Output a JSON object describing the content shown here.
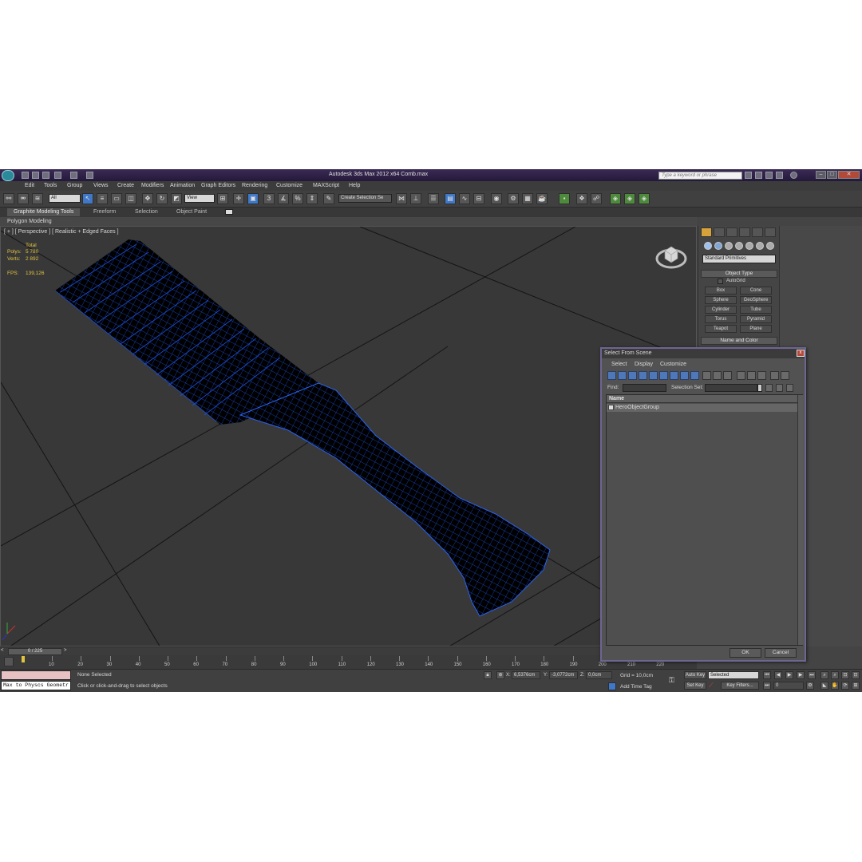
{
  "window": {
    "title": "Autodesk 3ds Max  2012 x64      Comb.max",
    "search_placeholder": "Type a keyword or phrase",
    "min_label": "–",
    "max_label": "□",
    "close_label": "✕"
  },
  "menu": [
    "Edit",
    "Tools",
    "Group",
    "Views",
    "Create",
    "Modifiers",
    "Animation",
    "Graph Editors",
    "Rendering",
    "Customize",
    "MAXScript",
    "Help"
  ],
  "toolbar": {
    "filter_value": "All",
    "ref_coord_value": "View",
    "named_selection_value": "Create Selection Se",
    "snap_label": "3"
  },
  "ribbon": {
    "tabs": [
      "Graphite Modeling Tools",
      "Freeform",
      "Selection",
      "Object Paint"
    ],
    "active_tab": "Graphite Modeling Tools",
    "panel_label": "Polygon Modeling"
  },
  "viewport": {
    "label": "[ + ] [ Perspective ] [ Realistic + Edged Faces ]",
    "stats": {
      "total_label": "Total",
      "polys_label": "Polys:",
      "polys_value": "5 780",
      "verts_label": "Verts:",
      "verts_value": "2 892",
      "fps_label": "FPS:",
      "fps_value": "139,126"
    },
    "model_color": "#000000",
    "wire_color": "#1d4fd8"
  },
  "command_panel": {
    "primitive_type": "Standard Primitives",
    "object_type_header": "Object Type",
    "autogrid_label": "AutoGrid",
    "primitives": [
      "Box",
      "Cone",
      "Sphere",
      "GeoSphere",
      "Cylinder",
      "Tube",
      "Torus",
      "Pyramid",
      "Teapot",
      "Plane"
    ],
    "name_color_header": "Name and Color"
  },
  "dialog": {
    "title": "Select From Scene",
    "close_label": "x",
    "menu": [
      "Select",
      "Display",
      "Customize"
    ],
    "find_label": "Find:",
    "selection_set_label": "Selection Set:",
    "column_name": "Name",
    "items": [
      "HeroObjectGroup"
    ],
    "ok_label": "OK",
    "cancel_label": "Cancel"
  },
  "timeline": {
    "frame_display": "0 / 225",
    "ticks": [
      "10",
      "20",
      "30",
      "40",
      "50",
      "60",
      "70",
      "80",
      "90",
      "100",
      "110",
      "120",
      "130",
      "140",
      "150",
      "160",
      "170",
      "180",
      "190",
      "200",
      "210",
      "220"
    ]
  },
  "status": {
    "maxscript_text": "Max to Physcs Geometr",
    "selection_status": "None Selected",
    "prompt": "Click or click-and-drag to select objects",
    "x_label": "X:",
    "x_value": "6,5376cm",
    "y_label": "Y:",
    "y_value": "-3,0772cm",
    "z_label": "Z:",
    "z_value": "0,0cm",
    "grid": "Grid = 10,0cm",
    "add_time_tag": "Add Time Tag",
    "auto_key": "Auto Key",
    "set_key": "Set Key",
    "key_mode_value": "Selected",
    "key_filters": "Key Filters...",
    "frame_value": "0"
  }
}
